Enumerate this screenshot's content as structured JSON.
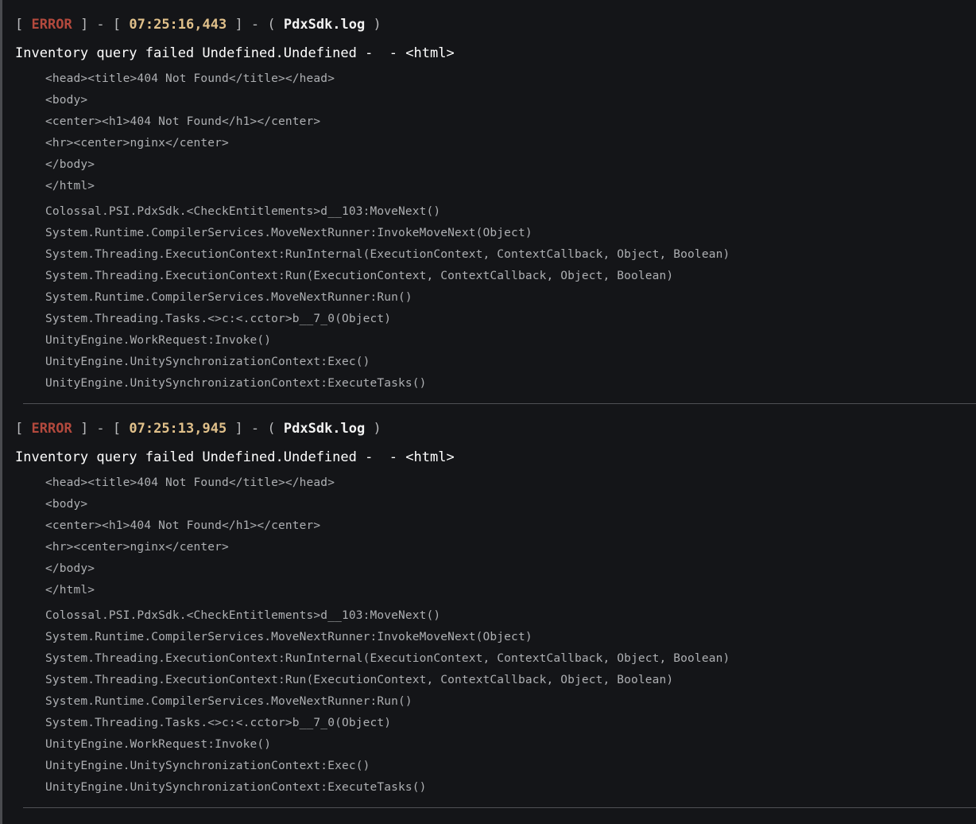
{
  "entries": [
    {
      "bracket_open": "[",
      "level": "ERROR",
      "sep1": "] - [",
      "time": "07:25:16,443",
      "sep2": "] - (",
      "file": "PdxSdk.log",
      "close": ")",
      "message": "Inventory query failed Undefined.Undefined -  - <html>",
      "body_lines": [
        "<head><title>404 Not Found</title></head>",
        "<body>",
        "<center><h1>404 Not Found</h1></center>",
        "<hr><center>nginx</center>",
        "</body>",
        "</html>"
      ],
      "trace_lines": [
        "Colossal.PSI.PdxSdk.<CheckEntitlements>d__103:MoveNext()",
        "System.Runtime.CompilerServices.MoveNextRunner:InvokeMoveNext(Object)",
        "System.Threading.ExecutionContext:RunInternal(ExecutionContext, ContextCallback, Object, Boolean)",
        "System.Threading.ExecutionContext:Run(ExecutionContext, ContextCallback, Object, Boolean)",
        "System.Runtime.CompilerServices.MoveNextRunner:Run()",
        "System.Threading.Tasks.<>c:<.cctor>b__7_0(Object)",
        "UnityEngine.WorkRequest:Invoke()",
        "UnityEngine.UnitySynchronizationContext:Exec()",
        "UnityEngine.UnitySynchronizationContext:ExecuteTasks()"
      ]
    },
    {
      "bracket_open": "[",
      "level": "ERROR",
      "sep1": "] - [",
      "time": "07:25:13,945",
      "sep2": "] - (",
      "file": "PdxSdk.log",
      "close": ")",
      "message": "Inventory query failed Undefined.Undefined -  - <html>",
      "body_lines": [
        "<head><title>404 Not Found</title></head>",
        "<body>",
        "<center><h1>404 Not Found</h1></center>",
        "<hr><center>nginx</center>",
        "</body>",
        "</html>"
      ],
      "trace_lines": [
        "Colossal.PSI.PdxSdk.<CheckEntitlements>d__103:MoveNext()",
        "System.Runtime.CompilerServices.MoveNextRunner:InvokeMoveNext(Object)",
        "System.Threading.ExecutionContext:RunInternal(ExecutionContext, ContextCallback, Object, Boolean)",
        "System.Threading.ExecutionContext:Run(ExecutionContext, ContextCallback, Object, Boolean)",
        "System.Runtime.CompilerServices.MoveNextRunner:Run()",
        "System.Threading.Tasks.<>c:<.cctor>b__7_0(Object)",
        "UnityEngine.WorkRequest:Invoke()",
        "UnityEngine.UnitySynchronizationContext:Exec()",
        "UnityEngine.UnitySynchronizationContext:ExecuteTasks()"
      ]
    }
  ],
  "colors": {
    "background": "#141518",
    "level_error": "#b3493d",
    "timestamp": "#e0c08a",
    "filename": "#f2f2f2",
    "message": "#ffffff",
    "detail_text": "#aeb0b3",
    "divider": "#4f5054"
  }
}
